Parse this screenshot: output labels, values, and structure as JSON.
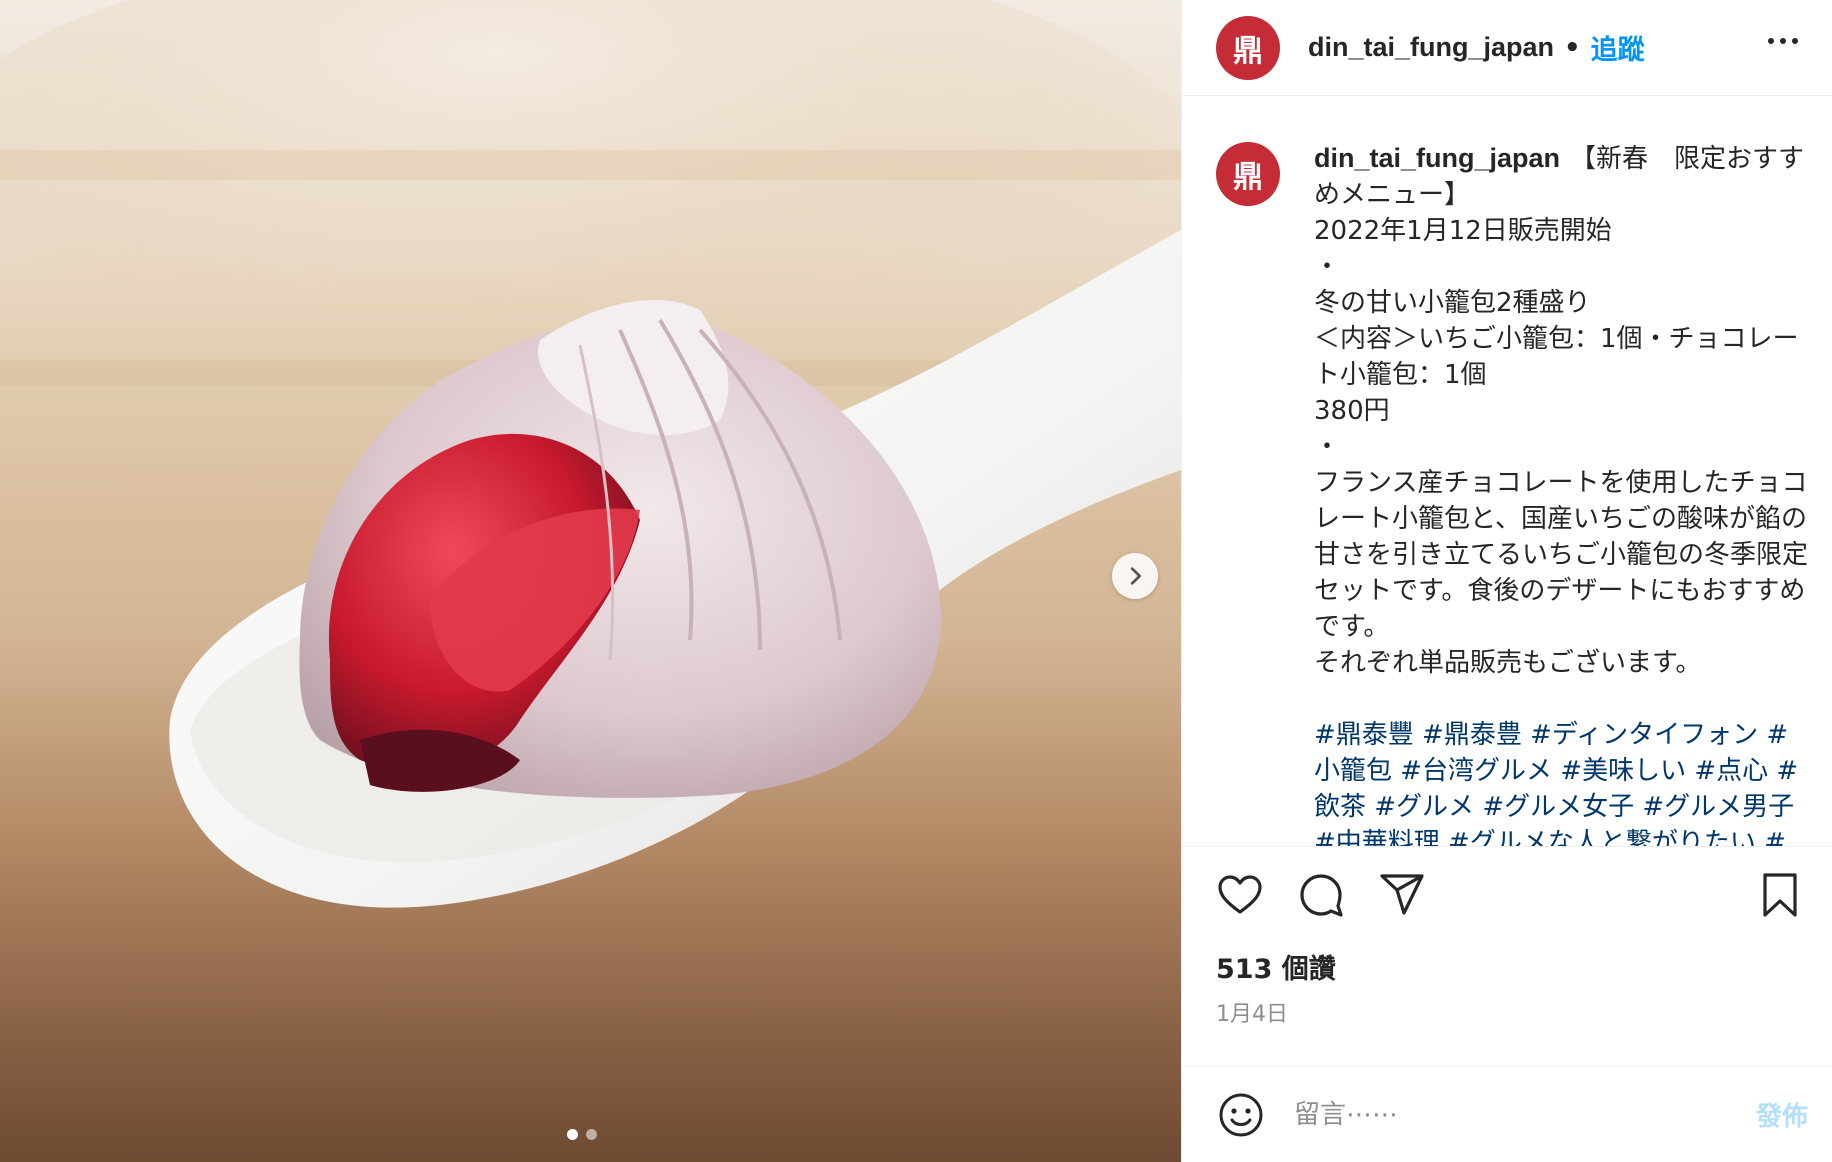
{
  "media": {
    "image_alt": "strawberry xiaolongbao dumpling on a white porcelain spoon",
    "carousel_total": 2,
    "carousel_current": 1
  },
  "header": {
    "avatar_glyph": "鼎",
    "username": "din_tai_fung_japan",
    "separator": "•",
    "follow_label": "追蹤"
  },
  "caption": {
    "username": "din_tai_fung_japan",
    "lines": [
      "【新春　限定おすすめメニュー】",
      "2022年1月12日販売開始",
      "・",
      "冬の甘い小籠包2種盛り",
      "＜内容＞いちご小籠包：1個・チョコレート小籠包：1個",
      "380円",
      "・",
      "フランス産チョコレートを使用したチョコレート小籠包と、国産いちごの酸味が餡の甘さを引き立てるいちご小籠包の冬季限定セットです。食後のデザートにもおすすめです。",
      "それぞれ単品販売もございます。"
    ],
    "hashtags": "#鼎泰豐 #鼎泰豊 #ディンタイフォン #小籠包 #台湾グルメ #美味しい #点心 #飲茶 #グルメ #グルメ女子 #グルメ男子 #中華料理 #グルメな人と繋がりたい #"
  },
  "actions": {
    "like_icon": "heart-icon",
    "comment_icon": "comment-icon",
    "share_icon": "paper-plane-icon",
    "save_icon": "bookmark-icon"
  },
  "stats": {
    "likes_text": "513 個讚",
    "date_text": "1月4日"
  },
  "comment": {
    "emoji_icon": "smiley-icon",
    "placeholder": "留言⋯⋯",
    "post_label": "發佈"
  },
  "colors": {
    "brand_red": "#c62c36",
    "link_blue": "#0095f6",
    "hashtag_blue": "#00376b",
    "post_disabled": "#b2dffc"
  }
}
